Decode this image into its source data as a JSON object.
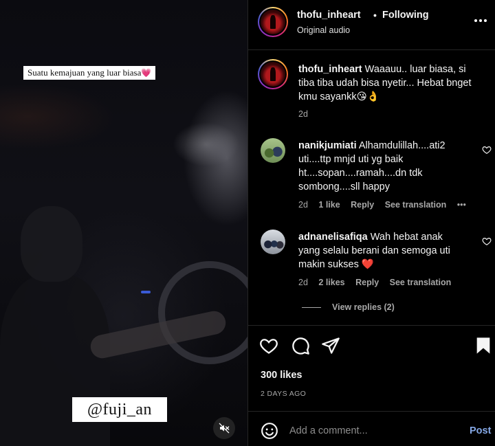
{
  "video": {
    "caption_text": "Suatu kemajuan yang luar biasa",
    "caption_emoji": "💗",
    "tag_text": "@fuji_an",
    "mute_icon": "speaker-muted-icon"
  },
  "header": {
    "username": "thofu_inheart",
    "separator": "•",
    "follow_status": "Following",
    "audio_label": "Original audio",
    "more_icon": "more-horizontal-icon"
  },
  "caption": {
    "username": "thofu_inheart",
    "text": "Waaauu.. luar biasa, si tiba tiba udah bisa nyetir... Hebat bnget kmu sayankk😘👌",
    "time": "2d"
  },
  "comments": [
    {
      "username": "nanikjumiati",
      "text": "Alhamdulillah....ati2 uti....ttp mnjd uti yg baik ht....sopan....ramah....dn tdk sombong....sll happy",
      "time": "2d",
      "likes": "1 like",
      "reply_label": "Reply",
      "translate_label": "See translation",
      "options": "•••"
    },
    {
      "username": "adnanelisafiqa",
      "text": "Wah hebat anak yang selalu berani dan semoga uti makin sukses ❤️",
      "time": "2d",
      "likes": "2 likes",
      "reply_label": "Reply",
      "translate_label": "See translation",
      "view_replies": "View replies (2)"
    }
  ],
  "actions": {
    "likes": "300 likes",
    "date": "2 DAYS AGO"
  },
  "add_comment": {
    "placeholder": "Add a comment...",
    "post_label": "Post"
  },
  "colors": {
    "background": "#000000",
    "text": "#f5f5f5",
    "secondary": "#a8a8a8",
    "post_link": "#85a8e6",
    "heart_red": "#ed4956"
  }
}
